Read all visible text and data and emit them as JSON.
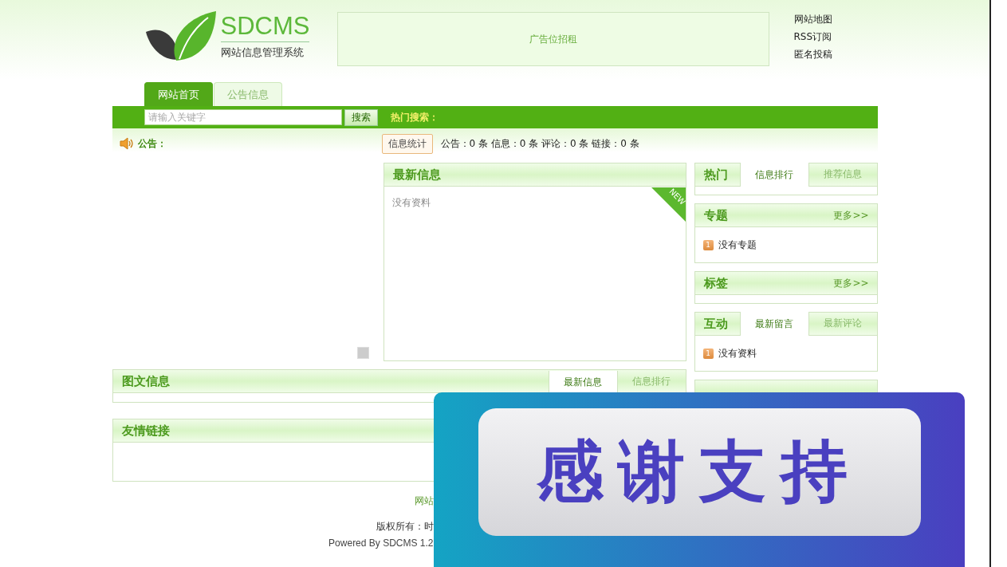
{
  "header": {
    "logo": {
      "title": "SDCMS",
      "subtitle": "网站信息管理系统"
    },
    "ad": "广告位招租",
    "links": [
      "网站地图",
      "RSS订阅",
      "匿名投稿"
    ]
  },
  "nav": {
    "tabs": [
      {
        "label": "网站首页",
        "selected": true
      },
      {
        "label": "公告信息",
        "selected": false
      }
    ]
  },
  "search": {
    "placeholder": "请输入关键字",
    "button": "搜索",
    "hot_label": "热门搜索："
  },
  "notice": {
    "label": "公告：",
    "stats_tag": "信息统计",
    "stats": "公告：0 条 信息：0 条 评论：0 条 链接：0 条"
  },
  "latest": {
    "title": "最新信息",
    "ribbon": "NEW",
    "empty": "没有资料"
  },
  "sidebar": [
    {
      "kind": "tabs",
      "title": "热门",
      "tabs": [
        {
          "label": "信息排行",
          "selected": true
        },
        {
          "label": "推荐信息",
          "selected": false
        }
      ]
    },
    {
      "kind": "more",
      "title": "专题",
      "more": "更多>>",
      "items": [
        {
          "rank": "1",
          "text": "没有专题"
        }
      ]
    },
    {
      "kind": "more",
      "title": "标签",
      "more": "更多>>"
    },
    {
      "kind": "tabs",
      "title": "互动",
      "tabs": [
        {
          "label": "最新留言",
          "selected": true
        },
        {
          "label": "最新评论",
          "selected": false
        }
      ],
      "items": [
        {
          "rank": "1",
          "text": "没有资料"
        }
      ]
    },
    {
      "kind": "plain"
    }
  ],
  "picture_info": {
    "title": "图文信息",
    "tabs": [
      {
        "label": "最新信息",
        "selected": true
      },
      {
        "label": "信息排行",
        "selected": false
      }
    ]
  },
  "friend_links": {
    "title": "友情链接"
  },
  "footer": {
    "nav": "网站",
    "copyright": "版权所有：时",
    "powered": "Powered By SDCMS 1.2"
  },
  "overlay": {
    "text": "感谢支持"
  }
}
